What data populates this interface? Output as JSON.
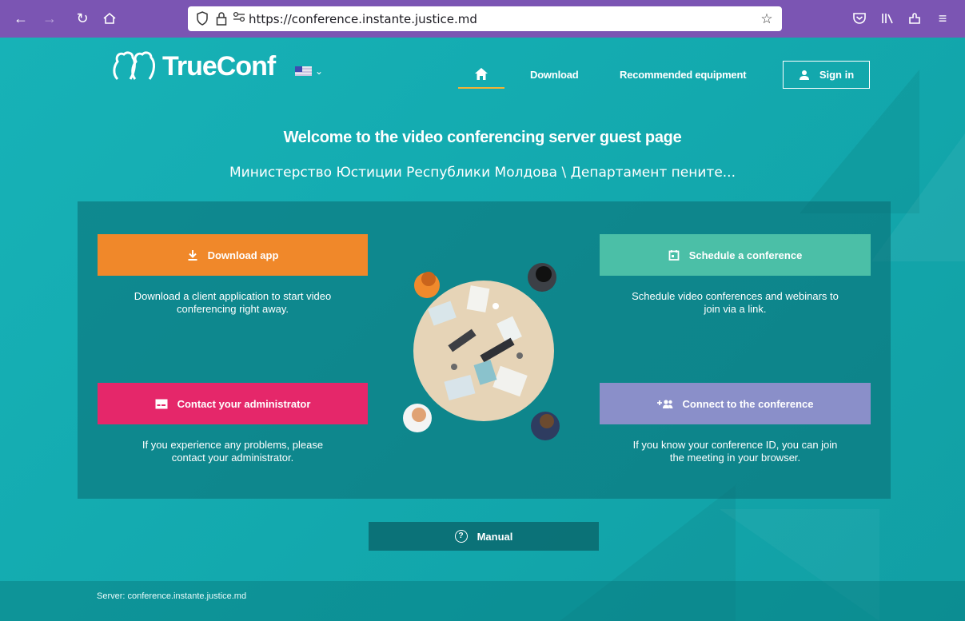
{
  "browser": {
    "url": "https://conference.instante.justice.md",
    "icons": [
      "back-arrow-icon",
      "forward-arrow-icon",
      "reload-icon",
      "home-icon",
      "shield-icon",
      "lock-icon",
      "permissions-icon",
      "star-icon",
      "pocket-icon",
      "library-icon",
      "extensions-icon",
      "menu-icon"
    ]
  },
  "header": {
    "logo_text": "TrueConf",
    "nav": {
      "download": "Download",
      "recommended": "Recommended equipment",
      "sign_in": "Sign in"
    }
  },
  "hero": {
    "welcome": "Welcome to the video conferencing server guest page",
    "subtitle": "Министерство Юстиции Республики Молдова \\ Департамент пените..."
  },
  "actions": {
    "download": {
      "label": "Download app",
      "desc_line1": "Download a client application to start video",
      "desc_line2": "conferencing right away.",
      "color": "#f0882a"
    },
    "schedule": {
      "label": "Schedule a conference",
      "desc_line1": "Schedule video conferences and webinars to",
      "desc_line2": "join via a link.",
      "color": "#4bbfa7"
    },
    "contact": {
      "label": "Contact your administrator",
      "desc_line1": "If you experience any problems, please",
      "desc_line2": "contact your administrator.",
      "color": "#e5276a"
    },
    "connect": {
      "label": "Connect to the conference",
      "desc_line1": "If you know your conference ID, you can join",
      "desc_line2": "the meeting in your browser.",
      "color": "#8a8fc9"
    }
  },
  "manual": {
    "label": "Manual"
  },
  "footer": {
    "server": "Server: conference.instante.justice.md"
  },
  "colors": {
    "browser_bar": "#7b55b3",
    "page_bg": "#14a8ad",
    "accent": "#f4b335"
  }
}
